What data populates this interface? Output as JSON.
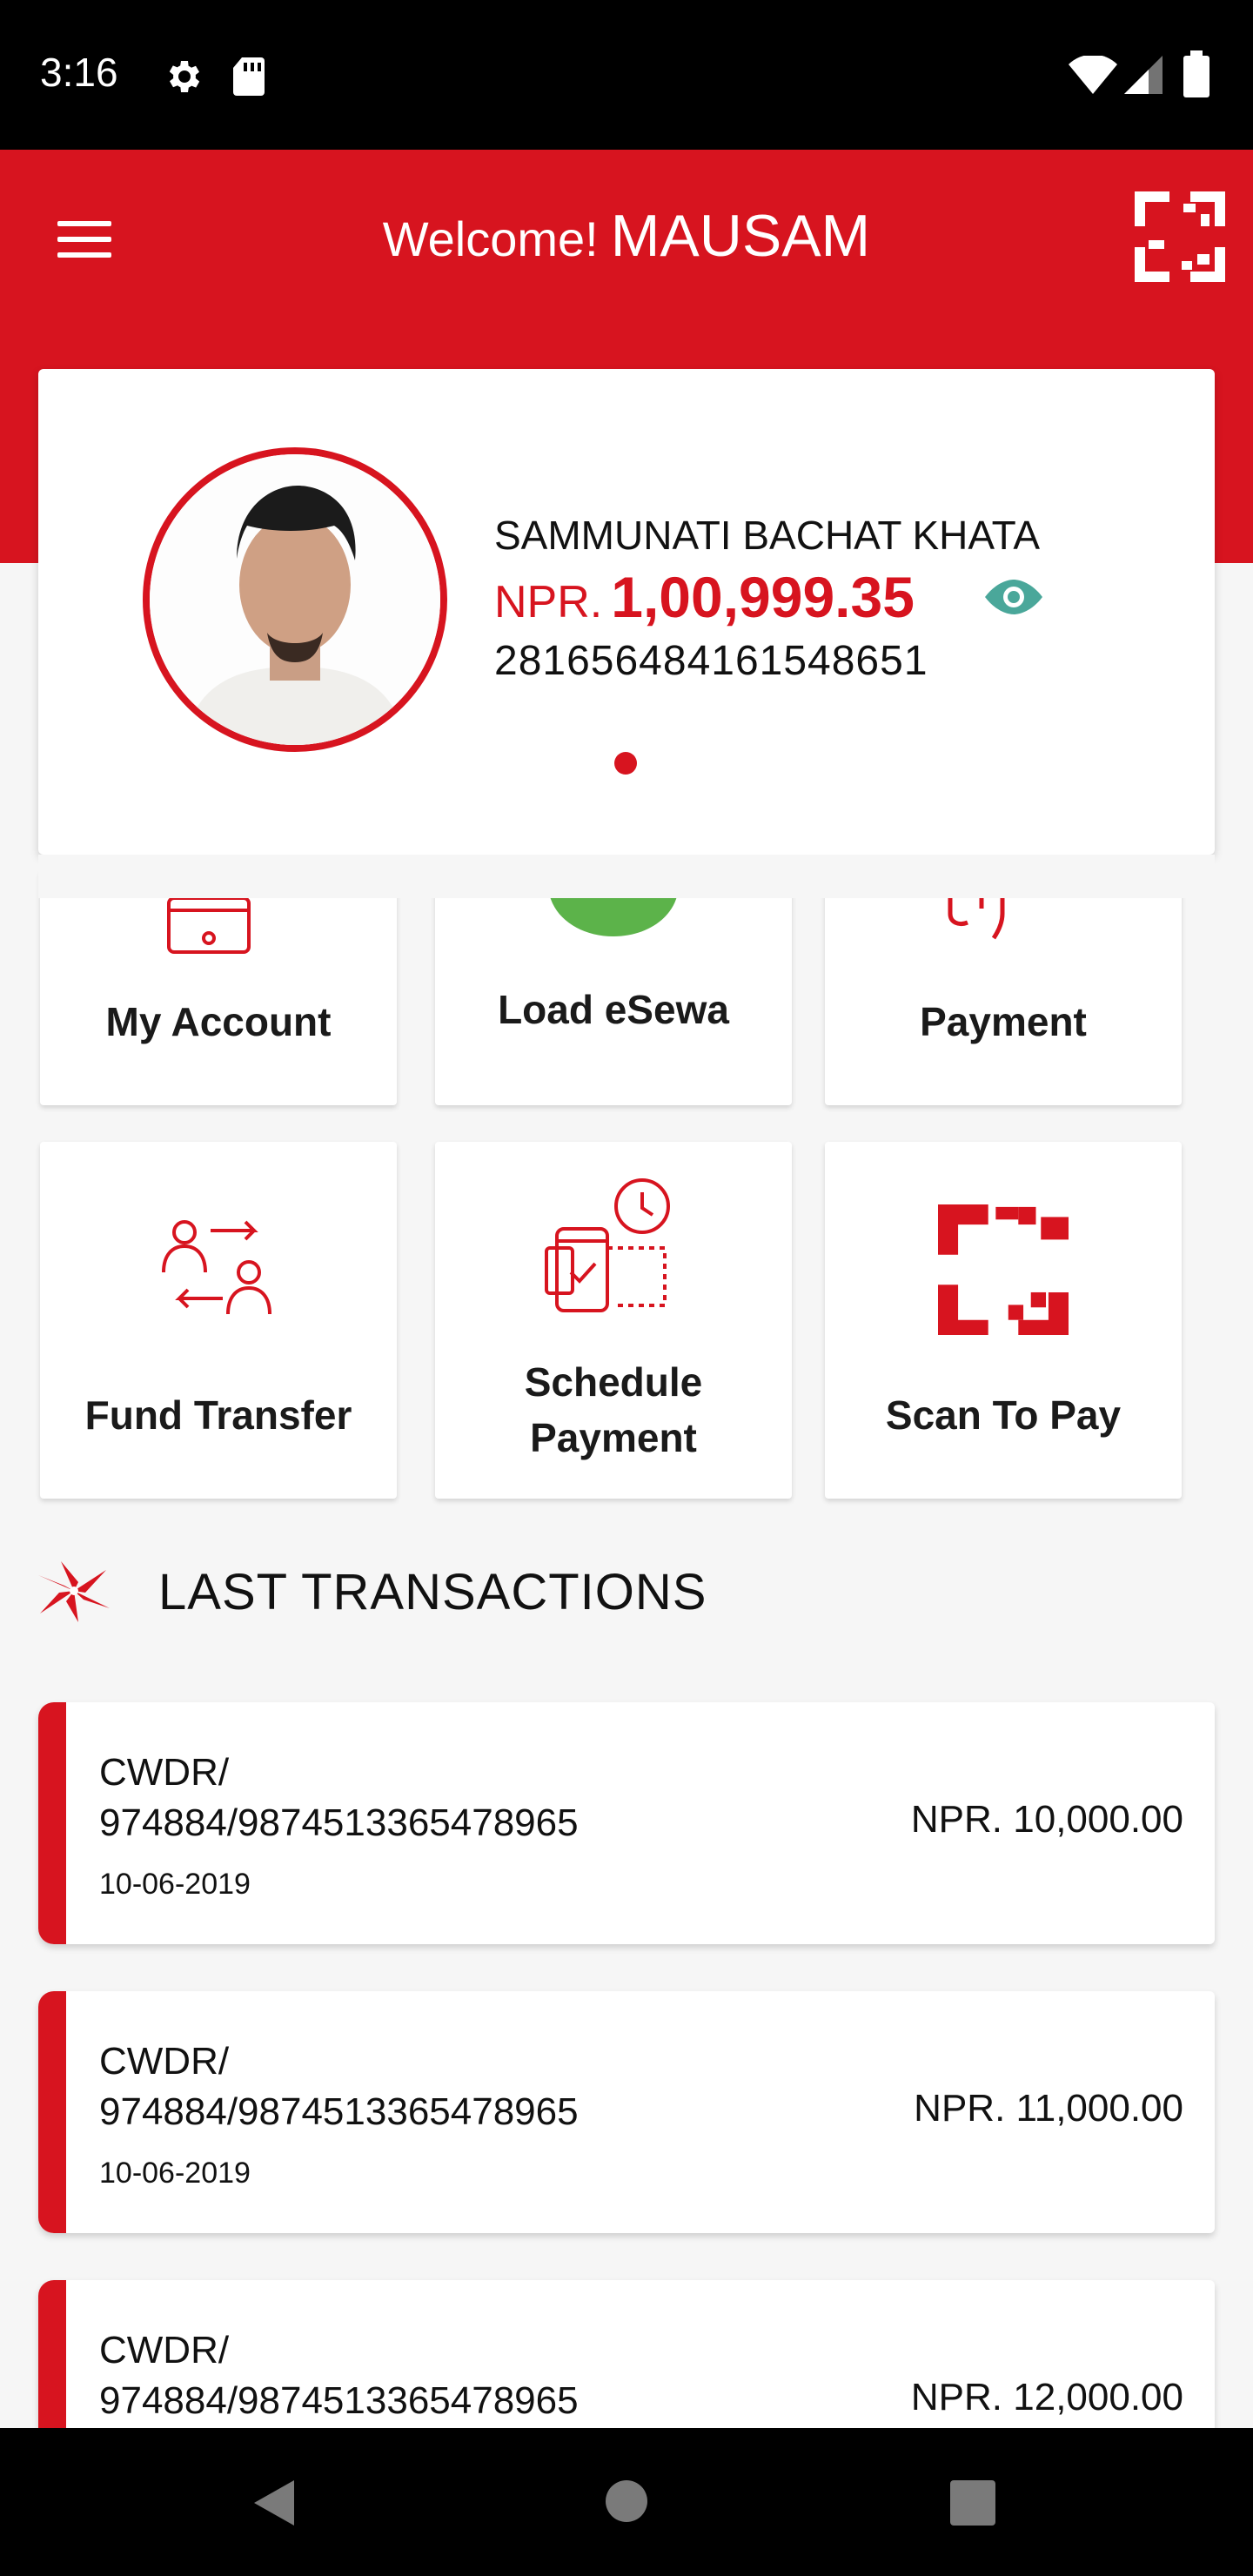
{
  "status_bar": {
    "time": "3:16",
    "icons": [
      "gear-icon",
      "sd-card-icon",
      "wifi-icon",
      "signal-icon",
      "battery-icon"
    ]
  },
  "header": {
    "welcome": "Welcome!",
    "user_name": "MAUSAM",
    "menu_icon": "hamburger-menu-icon",
    "qr_icon": "qr-scan-icon"
  },
  "account": {
    "name": "SAMMUNATI BACHAT KHATA",
    "currency": "NPR.",
    "balance": "1,00,999.35",
    "number": "281656484161548651"
  },
  "tiles": [
    {
      "label": "My Account",
      "icon": "account-card-icon"
    },
    {
      "label": "Load eSewa",
      "icon": "esewa-icon"
    },
    {
      "label": "Payment",
      "icon": "payment-icon"
    },
    {
      "label": "Fund Transfer",
      "icon": "fund-transfer-icon"
    },
    {
      "label": "Schedule Payment",
      "icon": "schedule-payment-icon"
    },
    {
      "label": "Scan To Pay",
      "icon": "qr-scan-icon"
    }
  ],
  "section": {
    "title": "LAST TRANSACTIONS"
  },
  "transactions": [
    {
      "ref_line1": "CWDR/",
      "ref_line2": "974884/9874513365478965",
      "date": "10-06-2019",
      "amount": "NPR. 10,000.00"
    },
    {
      "ref_line1": "CWDR/",
      "ref_line2": "974884/9874513365478965",
      "date": "10-06-2019",
      "amount": "NPR. 11,000.00"
    },
    {
      "ref_line1": "CWDR/",
      "ref_line2": "974884/9874513365478965",
      "date": "",
      "amount": "NPR. 12,000.00"
    }
  ],
  "colors": {
    "brand_red": "#d7141f",
    "eye_teal": "#4aa79a",
    "esewa_green": "#5cb34a"
  }
}
